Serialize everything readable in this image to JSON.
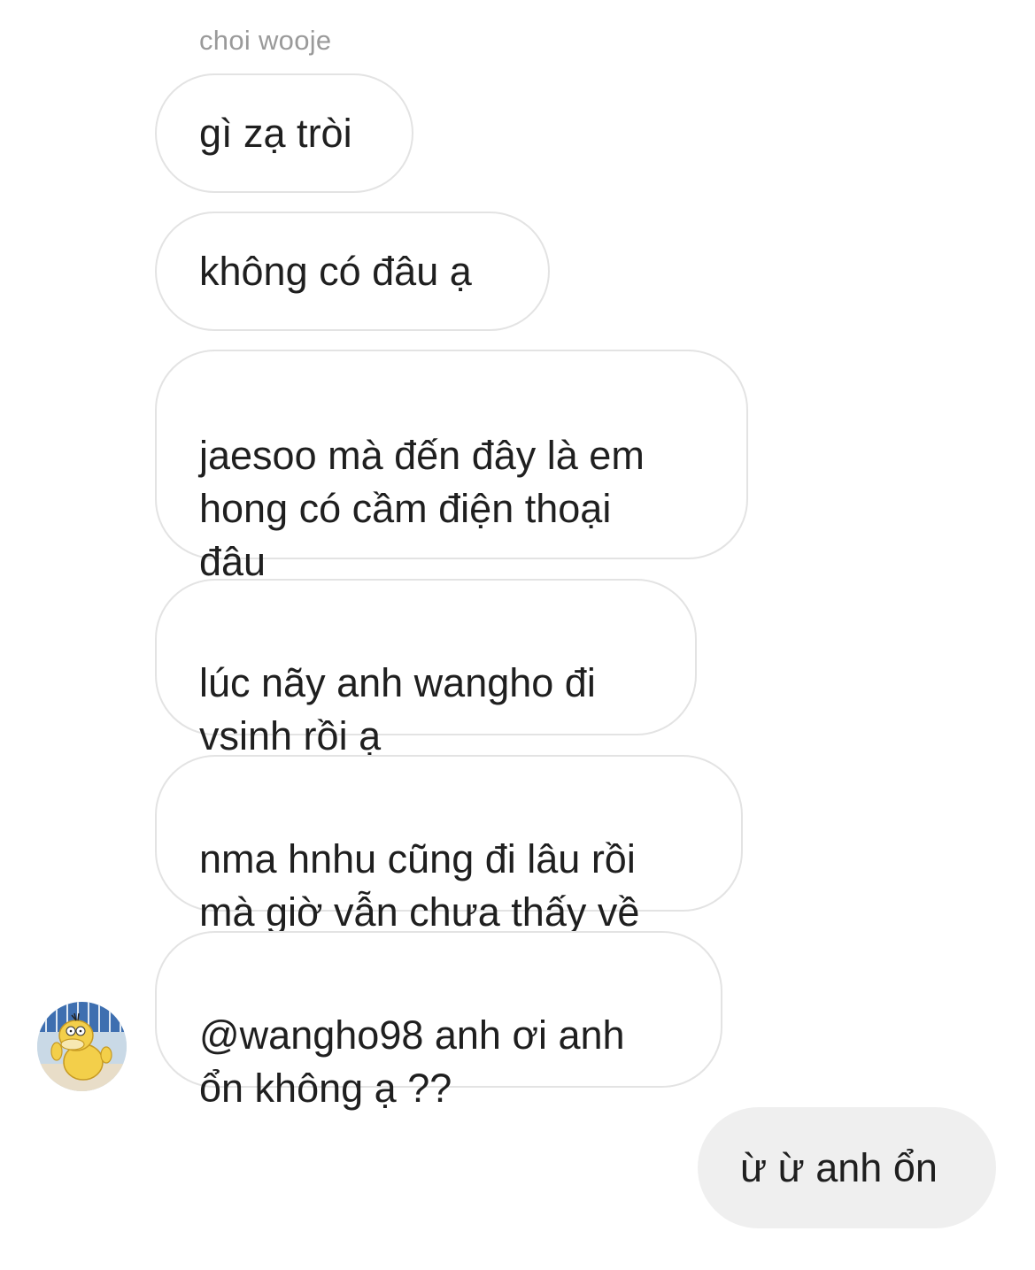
{
  "conversation": {
    "sender_name": "choi wooje",
    "incoming_messages": [
      {
        "text": "gì zạ tròi"
      },
      {
        "text": "không có đâu ạ"
      },
      {
        "text": "jaesoo mà đến đây là em\nhong có cầm điện thoại\nđâu"
      },
      {
        "text": "lúc nãy anh wangho đi\nvsinh rồi ạ"
      },
      {
        "text": "nma hnhu cũng đi lâu rồi\nmà giờ vẫn chưa thấy về"
      },
      {
        "text": "@wangho98 anh ơi anh\nổn không ạ ??"
      }
    ],
    "outgoing_messages": [
      {
        "text": "ừ ừ anh ổn"
      }
    ],
    "avatar": {
      "icon": "yellow-duck-avatar-icon"
    }
  },
  "colors": {
    "incoming_bubble_border": "#e3e3e3",
    "outgoing_bubble_bg": "#efefef",
    "sender_name": "#9a9a9a",
    "text": "#1f1f1f"
  }
}
